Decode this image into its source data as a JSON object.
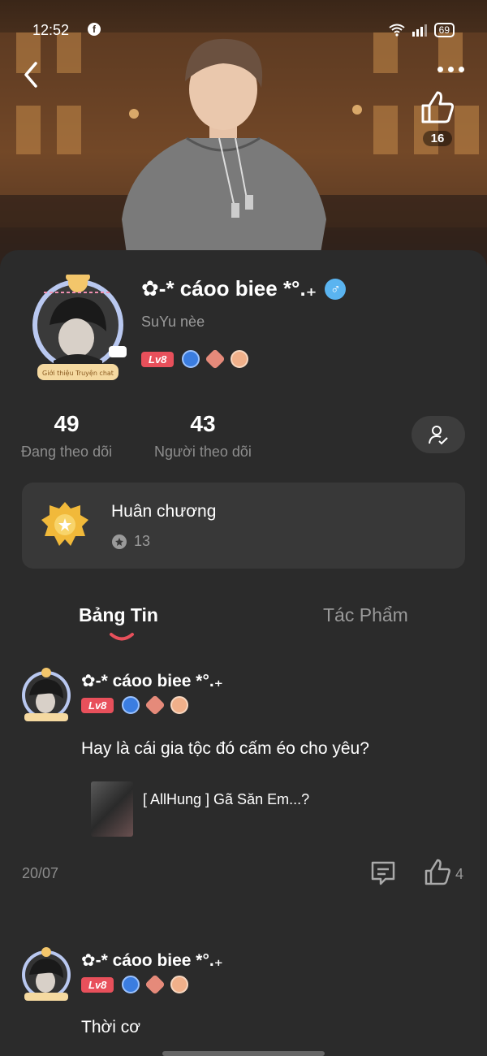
{
  "status": {
    "time": "12:52",
    "battery": "69"
  },
  "header": {
    "like_count": "16"
  },
  "profile": {
    "name": "✿-* cáoo biee *°.₊",
    "subtitle": "SuYu nèe",
    "level": "Lv8",
    "frame_label": "Giới thiệu Truyện chat",
    "gender_symbol": "♂"
  },
  "stats": {
    "following": {
      "value": "49",
      "label": "Đang theo dõi"
    },
    "followers": {
      "value": "43",
      "label": "Người theo dõi"
    }
  },
  "medal": {
    "title": "Huân chương",
    "count": "13"
  },
  "tabs": [
    {
      "label": "Bảng Tin",
      "active": true
    },
    {
      "label": "Tác Phẩm",
      "active": false
    }
  ],
  "posts": [
    {
      "author": "✿-* cáoo biee *°.₊",
      "level": "Lv8",
      "text": "Hay là cái gia tộc đó cấm éo cho yêu?",
      "attachment_title": "[ AllHung ] Gã Săn Em...?",
      "date": "20/07",
      "likes": "4"
    },
    {
      "author": "✿-* cáoo biee *°.₊",
      "level": "Lv8",
      "text": "Thời cơ"
    }
  ],
  "colors": {
    "accent": "#e8505b",
    "background": "#2b2b2b",
    "card": "#383838",
    "gender": "#5ab4f0"
  }
}
